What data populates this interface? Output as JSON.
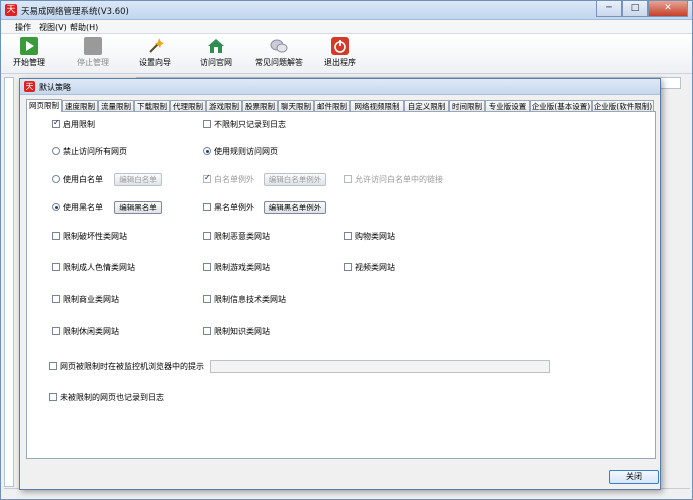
{
  "app": {
    "title": "天易成网络管理系统(V3.60)",
    "logo_glyph": "天",
    "window_controls": [
      "─",
      "□",
      "✕"
    ]
  },
  "menu": [
    "操作",
    "视图(V)",
    "帮助(H)"
  ],
  "toolbar": [
    {
      "label": "开始管理",
      "icon": "start-icon",
      "color": "#3a9b3a"
    },
    {
      "label": "停止管理",
      "icon": "stop-icon",
      "color": "#9a9a9a",
      "disabled": true
    },
    {
      "label": "设置向导",
      "icon": "wizard-icon",
      "color": "#d08a1a"
    },
    {
      "label": "访问官网",
      "icon": "home-icon",
      "color": "#2f8f4f"
    },
    {
      "label": "常见问题解答",
      "icon": "faq-icon",
      "color": "#8a8fa0"
    },
    {
      "label": "退出程序",
      "icon": "power-icon",
      "color": "#d33a2a"
    }
  ],
  "dialog": {
    "title": "默认策略",
    "logo_glyph": "天",
    "close_label": "关闭",
    "tabs": [
      {
        "label": "网页限制",
        "active": true
      },
      {
        "label": "速度限制"
      },
      {
        "label": "流量限制"
      },
      {
        "label": "下载限制"
      },
      {
        "label": "代理限制"
      },
      {
        "label": "游戏限制"
      },
      {
        "label": "股票限制"
      },
      {
        "label": "聊天限制"
      },
      {
        "label": "邮件限制"
      },
      {
        "label": "网络视频限制"
      },
      {
        "label": "自定义限制"
      },
      {
        "label": "时间限制"
      },
      {
        "label": "专业版设置"
      },
      {
        "label": "企业版(基本设置)"
      },
      {
        "label": "企业版(软件限制)"
      }
    ],
    "web": {
      "enable_limit": "启用限制",
      "no_limit_log_only": "不限制只记录到日志",
      "forbid_all": "禁止访问所有网页",
      "use_rules": "使用规则访问网页",
      "use_whitelist": "使用白名单",
      "edit_whitelist": "编辑白名单",
      "whitelist_exception": "白名单例外",
      "edit_whitelist_exception": "编辑白名单例外",
      "allow_whitelist_links": "允许访问白名单中的链接",
      "use_blacklist": "使用黑名单",
      "edit_blacklist": "编辑黑名单",
      "blacklist_exception": "黑名单例外",
      "edit_blacklist_exception": "编辑黑名单例外",
      "categories": {
        "destructive": "限制破坏性类网站",
        "malicious": "限制恶意类网站",
        "shopping": "购物类网站",
        "adult": "限制成人色情类网站",
        "games": "限制游戏类网站",
        "video": "视频类网站",
        "commerce": "限制商业类网站",
        "it": "限制信息技术类网站",
        "leisure": "限制休闲类网站",
        "knowledge": "限制知识类网站"
      },
      "show_hint": "网页被限制时在被监控机浏览器中的提示",
      "hint_value": "",
      "log_unlimited": "未被限制的网页也记录到日志"
    }
  }
}
